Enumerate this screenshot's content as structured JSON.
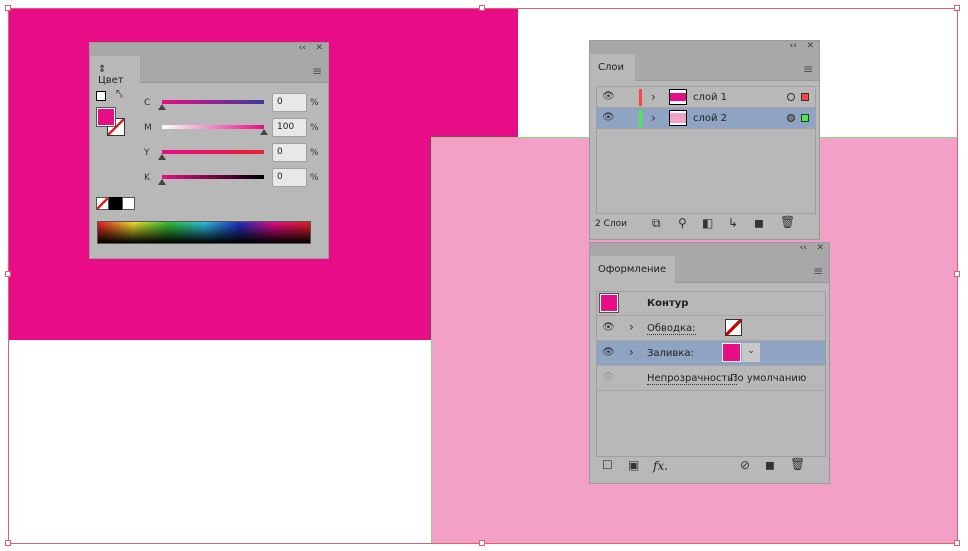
{
  "colors": {
    "magenta": "#e80c86",
    "pink": "#f2a0c6",
    "panel": "#b8b8b8",
    "selected": "#8fa4c2"
  },
  "color_panel": {
    "tab": "Цвет",
    "collapse": "‹‹",
    "close": "✕",
    "channels": [
      {
        "label": "C",
        "value": "0",
        "unit": "%",
        "percent": 0
      },
      {
        "label": "M",
        "value": "100",
        "unit": "%",
        "percent": 100
      },
      {
        "label": "Y",
        "value": "0",
        "unit": "%",
        "percent": 0
      },
      {
        "label": "K",
        "value": "0",
        "unit": "%",
        "percent": 0
      }
    ]
  },
  "layers_panel": {
    "tab": "Слои",
    "collapse": "‹‹",
    "close": "✕",
    "layers": [
      {
        "name": "слой 1",
        "color": "#ff4444"
      },
      {
        "name": "слой 2",
        "color": "#44ee44"
      }
    ],
    "footer": "2 Слои"
  },
  "appearance_panel": {
    "tab": "Оформление",
    "collapse": "‹‹",
    "close": "✕",
    "title": "Контур",
    "stroke_label": "Обводка:",
    "fill_label": "Заливка:",
    "opacity_label": "Непрозрачность:",
    "opacity_value": "По умолчанию",
    "fx": "fx."
  }
}
